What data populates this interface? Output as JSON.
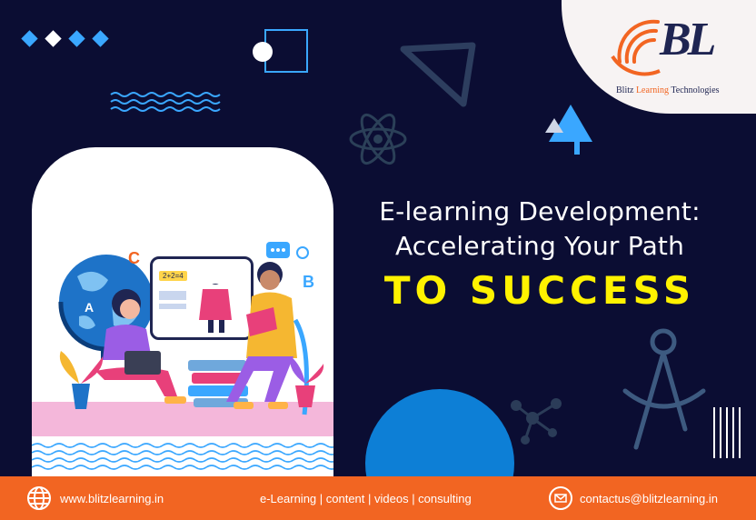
{
  "brand": {
    "logo_letters": "BL",
    "caption_part1": "Blitz ",
    "caption_part2": "Learning",
    "caption_part3": " Technologies",
    "brand_color": "#1f2552",
    "accent_color": "#f26522"
  },
  "headline": {
    "line1": "E-learning Development:",
    "line2": "Accelerating Your Path",
    "line3": "TO SUCCESS",
    "highlight_color": "#fff200"
  },
  "illustration": {
    "board_text": "2+2=4",
    "globe_letter": "A",
    "letter_c": "C",
    "letter_b": "B"
  },
  "footer": {
    "website": "www.blitzlearning.in",
    "services": "e-Learning | content | videos | consulting",
    "email": "contactus@blitzlearning.in",
    "website_icon": "globe-icon",
    "email_icon": "mail-icon"
  },
  "colors": {
    "background": "#0b0d33",
    "footer": "#f26522",
    "circle": "#0d7fd6",
    "diamonds": "#3aa7ff"
  }
}
